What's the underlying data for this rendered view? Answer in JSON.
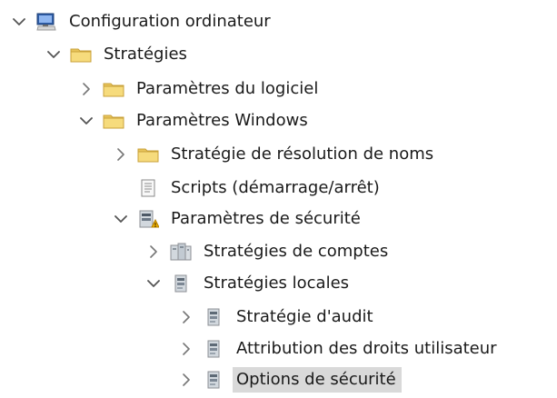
{
  "tree": [
    {
      "id": "configuration-ordinateur",
      "label": "Configuration ordinateur",
      "depth": 0,
      "expander": "expanded",
      "icon": "computer-icon",
      "selected": false
    },
    {
      "id": "strategies",
      "label": "Stratégies",
      "depth": 1,
      "expander": "expanded",
      "icon": "folder-icon",
      "selected": false
    },
    {
      "id": "parametres-du-logiciel",
      "label": "Paramètres du logiciel",
      "depth": 2,
      "expander": "collapsed",
      "icon": "folder-icon",
      "selected": false
    },
    {
      "id": "parametres-windows",
      "label": "Paramètres Windows",
      "depth": 2,
      "expander": "expanded",
      "icon": "folder-icon",
      "selected": false
    },
    {
      "id": "strategie-de-resolution-de-noms",
      "label": "Stratégie de résolution de noms",
      "depth": 3,
      "expander": "collapsed",
      "icon": "folder-icon",
      "selected": false
    },
    {
      "id": "scripts-demarrage-arret",
      "label": "Scripts (démarrage/arrêt)",
      "depth": 3,
      "expander": "none",
      "icon": "scripts-icon",
      "selected": false
    },
    {
      "id": "parametres-de-securite",
      "label": "Paramètres de sécurité",
      "depth": 3,
      "expander": "expanded",
      "icon": "security-settings-icon",
      "selected": false
    },
    {
      "id": "strategies-de-comptes",
      "label": "Stratégies de comptes",
      "depth": 4,
      "expander": "collapsed",
      "icon": "policy-books-icon",
      "selected": false
    },
    {
      "id": "strategies-locales",
      "label": "Stratégies locales",
      "depth": 4,
      "expander": "expanded",
      "icon": "policy-book-icon",
      "selected": false
    },
    {
      "id": "strategie-d-audit",
      "label": "Stratégie d'audit",
      "depth": 5,
      "expander": "collapsed",
      "icon": "policy-book-icon",
      "selected": false
    },
    {
      "id": "attribution-des-droits-utilisateur",
      "label": "Attribution des droits utilisateur",
      "depth": 5,
      "expander": "collapsed",
      "icon": "policy-book-icon",
      "selected": false
    },
    {
      "id": "options-de-securite",
      "label": "Options de sécurité",
      "depth": 5,
      "expander": "collapsed",
      "icon": "policy-book-icon",
      "selected": true
    }
  ],
  "colors": {
    "selection": "#d9d9d9",
    "folder": "#f3d36b",
    "folder_dark": "#d7af38",
    "chevron": "#555555",
    "text": "#1a1a1a"
  }
}
